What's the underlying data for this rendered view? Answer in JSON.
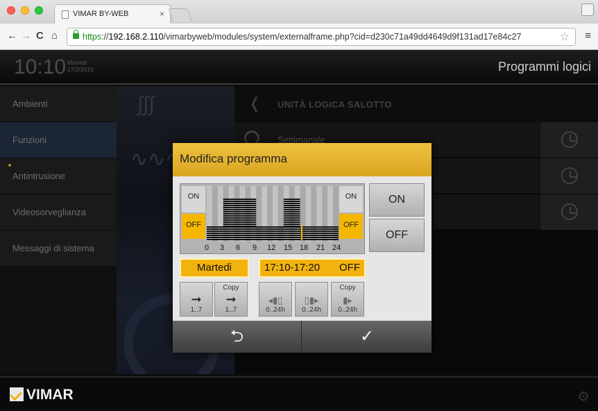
{
  "browser": {
    "tab_title": "VIMAR BY-WEB",
    "tab_close": "×",
    "url_scheme": "https",
    "url_sep": "://",
    "url_host": "192.168.2.110",
    "url_path": "/vimarbyweb/modules/system/externalframe.php?cid=d230c71a49dd4649d9f131ad17e84c27",
    "icons": {
      "back": "←",
      "forward": "→",
      "reload": "C",
      "home": "⌂",
      "star": "☆",
      "menu": "≡",
      "profile": "👤"
    }
  },
  "header": {
    "time": "10:10",
    "weekday": "Martedi",
    "date": "17/2/2015",
    "title": "Programmi logici"
  },
  "sidebar": {
    "items": [
      {
        "label": "Ambienti"
      },
      {
        "label": "Funzioni"
      },
      {
        "label": "Antintrusione"
      },
      {
        "label": "Videosorveglianza"
      },
      {
        "label": "Messaggi di sistema"
      }
    ]
  },
  "panel": {
    "back_chevron": "❬",
    "title": "UNITÀ LOGICA SALOTTO",
    "rows": [
      {
        "label": "Settimanale"
      },
      {
        "label": ""
      },
      {
        "label": ""
      }
    ]
  },
  "modal": {
    "title": "Modifica programma",
    "graph": {
      "on_label": "ON",
      "off_label": "OFF",
      "axis": [
        "0",
        "3",
        "6",
        "9",
        "12",
        "15",
        "18",
        "21",
        "24"
      ],
      "hours_range": [
        0,
        24
      ]
    },
    "on_button": "ON",
    "off_button": "OFF",
    "day": "Martedi",
    "time_range": "17:10-17:20",
    "time_state": "OFF",
    "tools": [
      {
        "caption": "",
        "icon": "arrow-right-icon",
        "glyph": "➞",
        "sub": "1..7"
      },
      {
        "caption": "Copy",
        "icon": "copy-arrow-icon",
        "glyph": "➞",
        "sub": "1..7"
      },
      {
        "caption": "",
        "icon": "shift-left-icon",
        "glyph": "◂▮▯",
        "sub": "0..24h"
      },
      {
        "caption": "",
        "icon": "shift-right-icon",
        "glyph": "▯▮▸",
        "sub": "0..24h"
      },
      {
        "caption": "Copy",
        "icon": "copy-bars-icon",
        "glyph": "▮▸",
        "sub": "0..24h"
      }
    ],
    "back_glyph": "⮌",
    "ok_glyph": "✓"
  },
  "footer": {
    "brand": "VIMAR",
    "gear": "⚙"
  },
  "colors": {
    "accent": "#f3b30f",
    "modal_header": "#e3b232",
    "app_bg": "#0d0d0d"
  }
}
